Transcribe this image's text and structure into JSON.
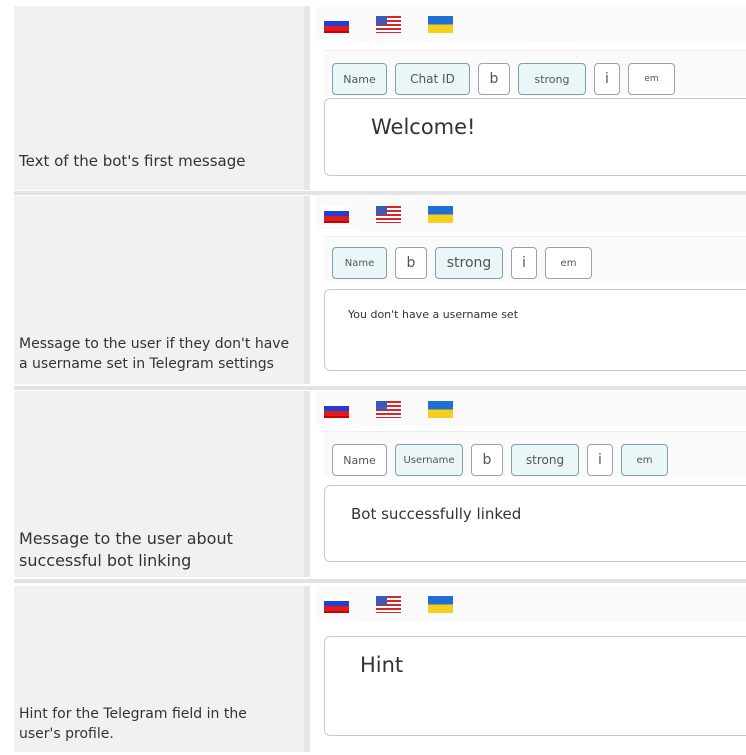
{
  "rows": [
    {
      "label": "Text of the bot's first message",
      "toolbar": [
        "Name",
        "Chat ID",
        "b",
        "strong",
        "i",
        "em"
      ],
      "editor_text": "Welcome!"
    },
    {
      "label": "Message to the user if they don't have a username set in Telegram settings",
      "toolbar": [
        "Name",
        "b",
        "strong",
        "i",
        "em"
      ],
      "editor_text": "You don't have a username set"
    },
    {
      "label": "Message to the user about successful bot linking",
      "toolbar": [
        "Name",
        "Username",
        "b",
        "strong",
        "i",
        "em"
      ],
      "editor_text": "Bot successfully linked"
    },
    {
      "label": "Hint for the Telegram field in the user's profile.",
      "toolbar": [],
      "editor_text": "Hint"
    }
  ],
  "languages": [
    "ru-flag-icon",
    "us-flag-icon",
    "ua-flag-icon"
  ]
}
